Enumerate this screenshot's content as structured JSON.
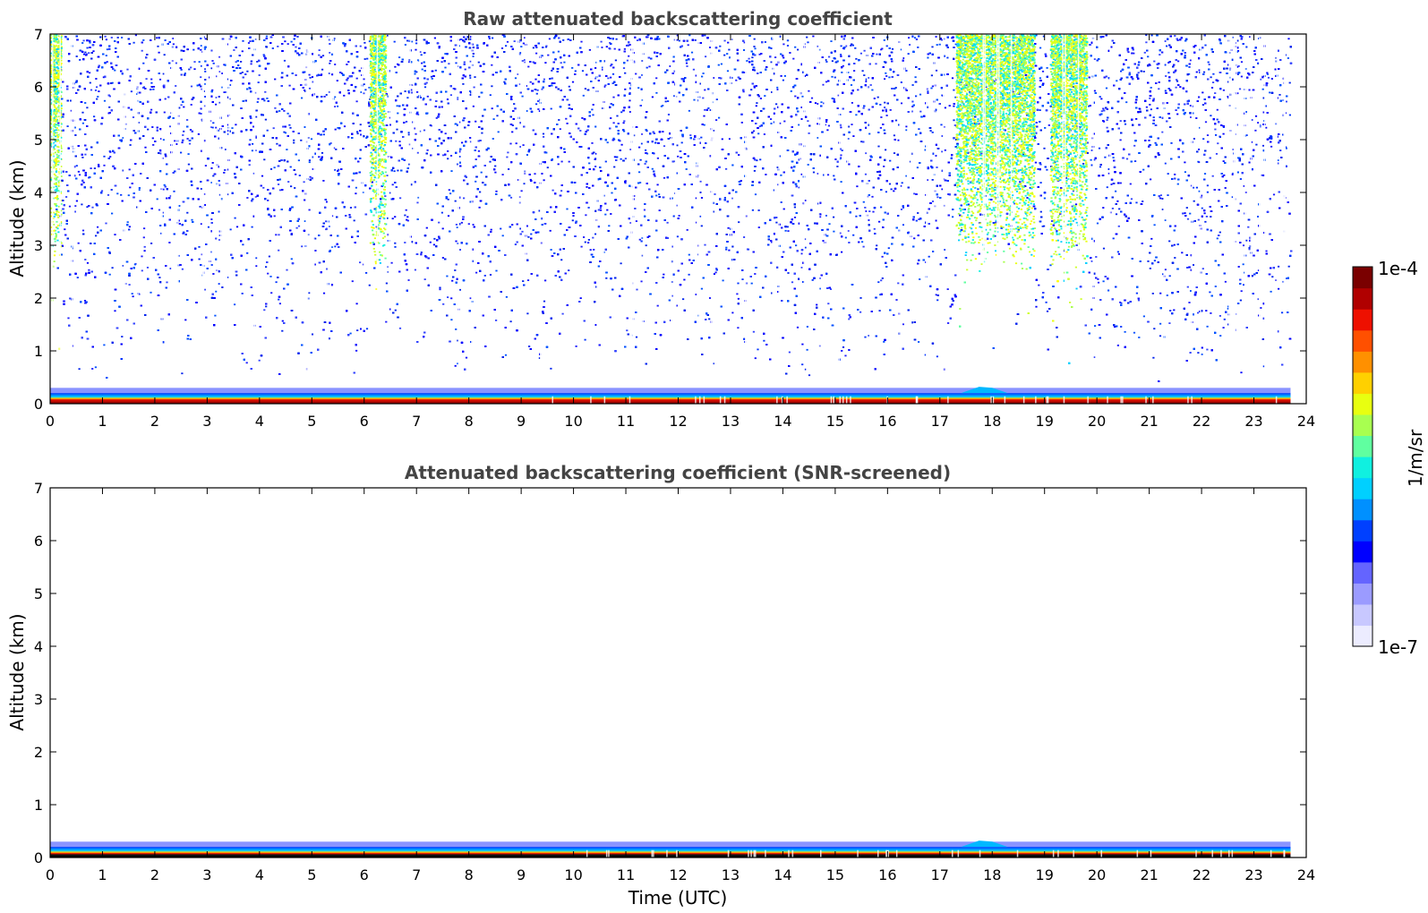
{
  "chart_data": [
    {
      "type": "heatmap",
      "title": "Raw attenuated backscattering coefficient",
      "xlabel": "",
      "ylabel": "Altitude (km)",
      "xlim": [
        0,
        24
      ],
      "ylim": [
        0,
        7
      ],
      "xticks": [
        "0",
        "1",
        "2",
        "3",
        "4",
        "5",
        "6",
        "7",
        "8",
        "9",
        "10",
        "11",
        "12",
        "13",
        "14",
        "15",
        "16",
        "17",
        "18",
        "19",
        "20",
        "21",
        "22",
        "23",
        "24"
      ],
      "yticks": [
        "0",
        "1",
        "2",
        "3",
        "4",
        "5",
        "6",
        "7"
      ],
      "data_end_time": 23.7,
      "features": {
        "surface_layer_top_km": 0.2,
        "noise_speckle_altitude_range_km": [
          0.4,
          7
        ],
        "high_noise_periods": [
          {
            "start": 17.3,
            "end": 18.8
          },
          {
            "start": 19.1,
            "end": 19.8
          },
          {
            "start": 6.1,
            "end": 6.4
          },
          {
            "start": 0.0,
            "end": 0.2
          }
        ]
      }
    },
    {
      "type": "heatmap",
      "title": "Attenuated backscattering coefficient (SNR-screened)",
      "xlabel": "Time (UTC)",
      "ylabel": "Altitude (km)",
      "xlim": [
        0,
        24
      ],
      "ylim": [
        0,
        7
      ],
      "xticks": [
        "0",
        "1",
        "2",
        "3",
        "4",
        "5",
        "6",
        "7",
        "8",
        "9",
        "10",
        "11",
        "12",
        "13",
        "14",
        "15",
        "16",
        "17",
        "18",
        "19",
        "20",
        "21",
        "22",
        "23",
        "24"
      ],
      "yticks": [
        "0",
        "1",
        "2",
        "3",
        "4",
        "5",
        "6",
        "7"
      ],
      "data_end_time": 23.7,
      "features": {
        "surface_layer_top_km": 0.2
      }
    }
  ],
  "colorbar": {
    "label": "1/m/sr",
    "max_label": "1e-4",
    "min_label": "1e-7",
    "scale": "log",
    "colormap": "jet",
    "colors": [
      "#ececff",
      "#c8c8ff",
      "#9b9bff",
      "#6464ff",
      "#0000ff",
      "#0040ff",
      "#0090ff",
      "#00d0ff",
      "#10f0e0",
      "#60ffa0",
      "#a8ff50",
      "#e8ff10",
      "#ffd000",
      "#ff9000",
      "#ff5000",
      "#ee1000",
      "#b00000",
      "#7a0000"
    ]
  }
}
